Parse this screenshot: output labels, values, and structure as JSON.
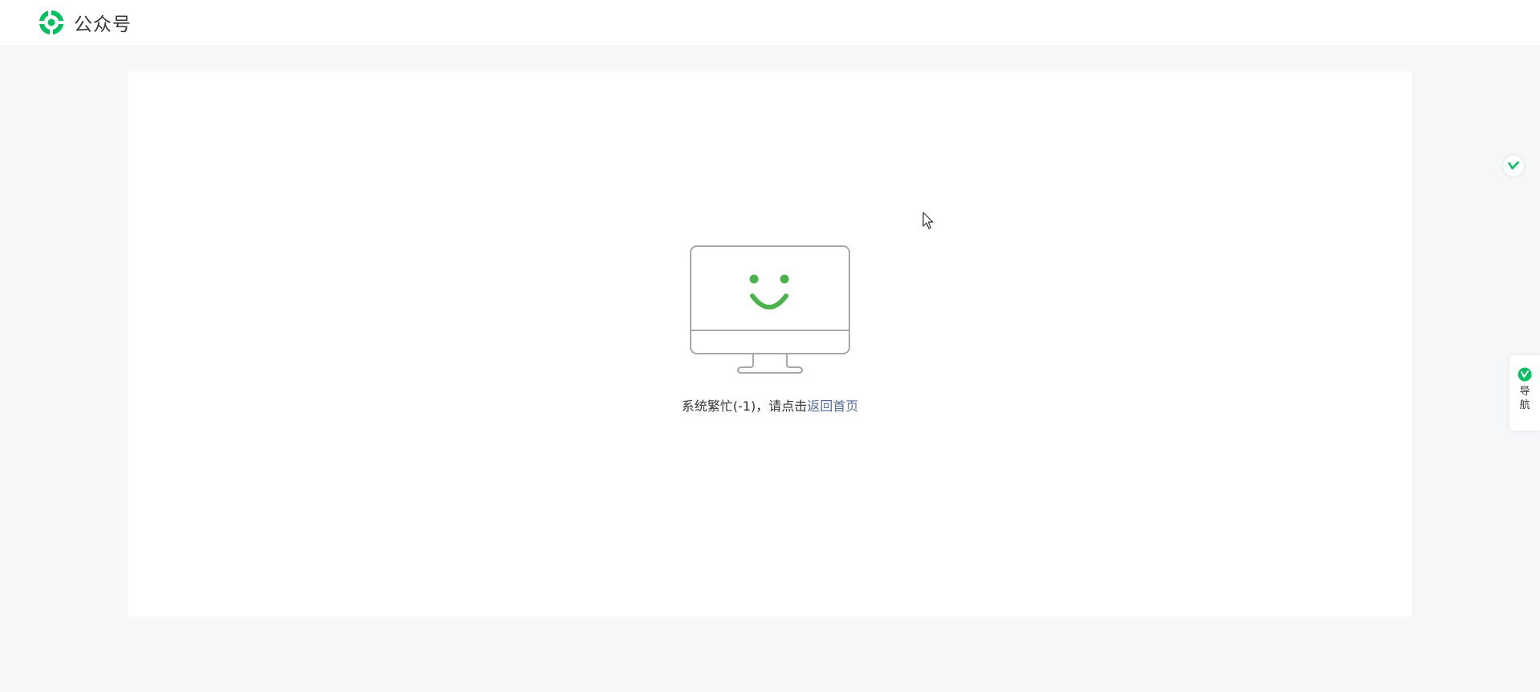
{
  "header": {
    "brand_name": "公众号",
    "logo_icon": "wechat-official-account-logo-icon",
    "brand_color": "#07c160"
  },
  "main": {
    "illustration_icon": "smiling-monitor-icon",
    "message_text": "系统繁忙(-1)，请点击",
    "home_link_label": "返回首页",
    "link_color": "#576b95"
  },
  "sidebar": {
    "float_icon": "green-check-icon",
    "nav_icon": "green-check-icon",
    "nav_label": "导航"
  }
}
